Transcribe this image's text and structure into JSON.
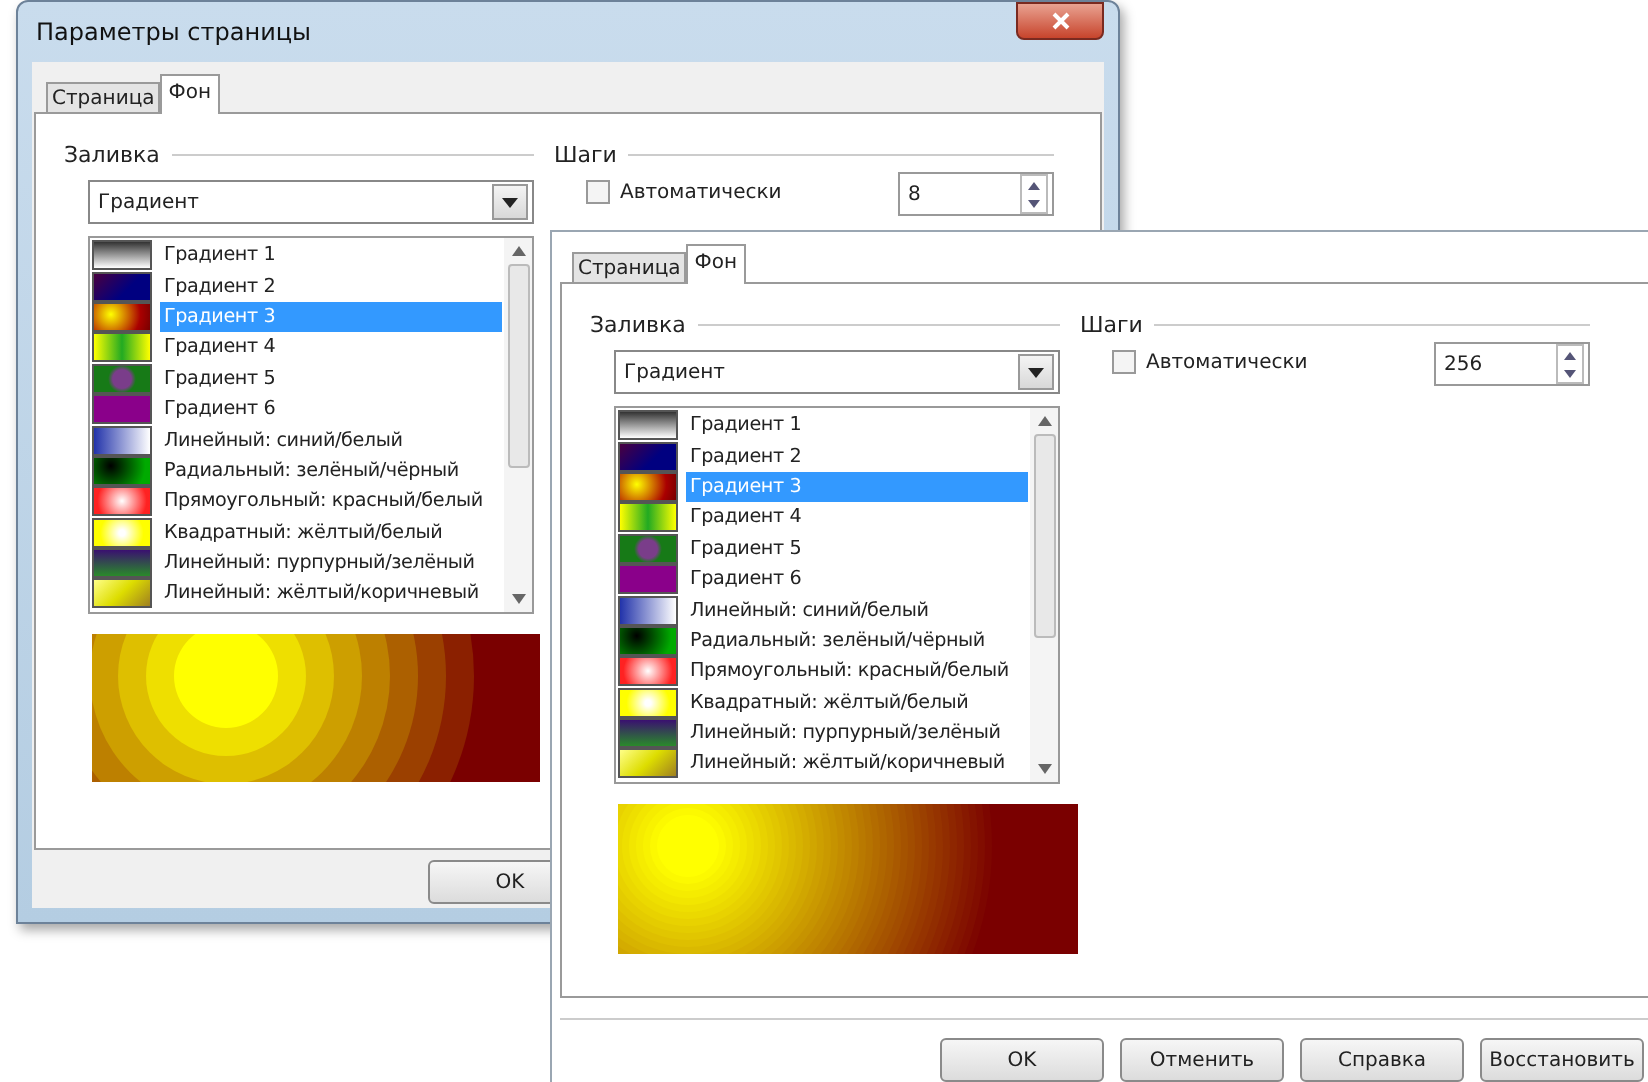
{
  "dialogs": [
    {
      "title": "Параметры страницы",
      "tabs": [
        {
          "label": "Страница",
          "selected": false
        },
        {
          "label": "Фон",
          "selected": true
        }
      ],
      "fill_label": "Заливка",
      "fill_type": "Градиент",
      "gradients": [
        {
          "label": "Градиент 1",
          "selected": false
        },
        {
          "label": "Градиент 2",
          "selected": false
        },
        {
          "label": "Градиент 3",
          "selected": true
        },
        {
          "label": "Градиент 4",
          "selected": false
        },
        {
          "label": "Градиент 5",
          "selected": false
        },
        {
          "label": "Градиент 6",
          "selected": false
        },
        {
          "label": "Линейный: синий/белый",
          "selected": false
        },
        {
          "label": "Радиальный: зелёный/чёрный",
          "selected": false
        },
        {
          "label": "Прямоугольный: красный/белый",
          "selected": false
        },
        {
          "label": "Квадратный: жёлтый/белый",
          "selected": false
        },
        {
          "label": "Линейный: пурпурный/зелёный",
          "selected": false
        },
        {
          "label": "Линейный: жёлтый/коричневый",
          "selected": false
        }
      ],
      "steps_label": "Шаги",
      "auto": {
        "label": "Автоматически",
        "checked": false
      },
      "steps": "8",
      "buttons": [
        "OK"
      ]
    },
    {
      "tabs": [
        {
          "label": "Страница",
          "selected": false
        },
        {
          "label": "Фон",
          "selected": true
        }
      ],
      "fill_label": "Заливка",
      "fill_type": "Градиент",
      "gradients": [
        {
          "label": "Градиент 1",
          "selected": false
        },
        {
          "label": "Градиент 2",
          "selected": false
        },
        {
          "label": "Градиент 3",
          "selected": true
        },
        {
          "label": "Градиент 4",
          "selected": false
        },
        {
          "label": "Градиент 5",
          "selected": false
        },
        {
          "label": "Градиент 6",
          "selected": false
        },
        {
          "label": "Линейный: синий/белый",
          "selected": false
        },
        {
          "label": "Радиальный: зелёный/чёрный",
          "selected": false
        },
        {
          "label": "Прямоугольный: красный/белый",
          "selected": false
        },
        {
          "label": "Квадратный: жёлтый/белый",
          "selected": false
        },
        {
          "label": "Линейный: пурпурный/зелёный",
          "selected": false
        },
        {
          "label": "Линейный: жёлтый/коричневый",
          "selected": false
        }
      ],
      "steps_label": "Шаги",
      "auto": {
        "label": "Автоматически",
        "checked": false
      },
      "steps": "256",
      "buttons": [
        "OK",
        "Отменить",
        "Справка",
        "Восстановить"
      ]
    }
  ]
}
